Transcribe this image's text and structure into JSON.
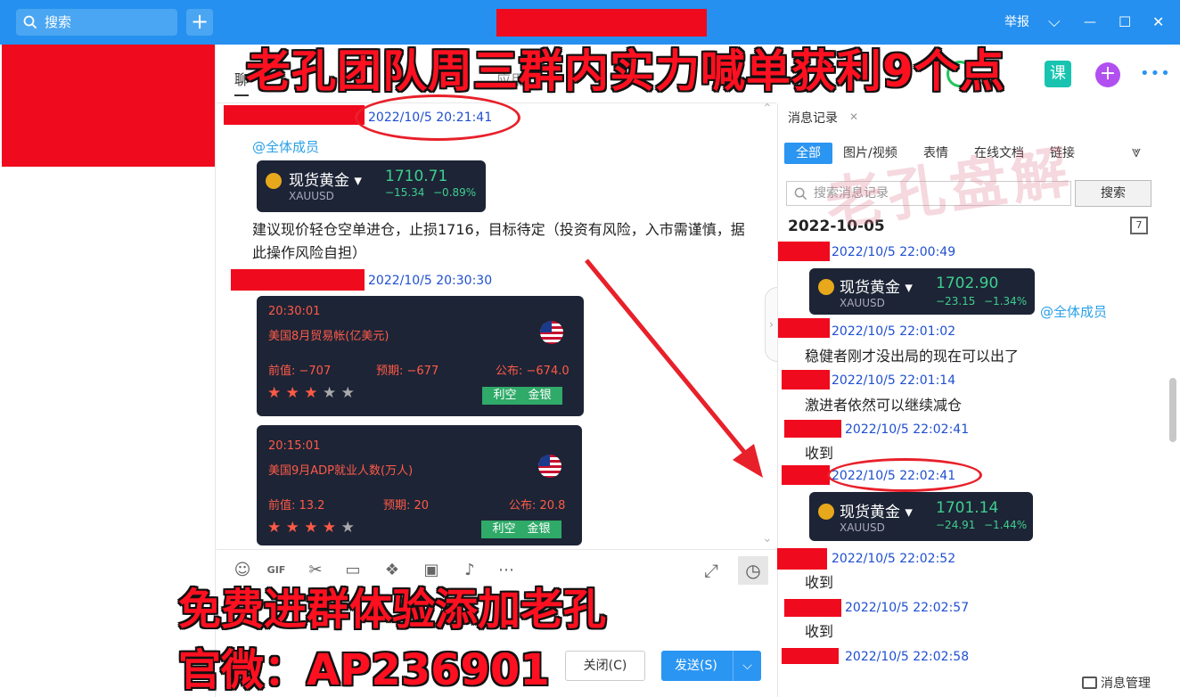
{
  "titlebar": {
    "search_placeholder": "搜索",
    "plus": "+",
    "report": "举报",
    "chevron": "⌵",
    "minimize": "—",
    "maximize": "☐",
    "close": "✕"
  },
  "overlay": {
    "title": "老孔团队周三群内实力喊单获利9个点",
    "bottom_line1": "免费进群体验添加老孔",
    "bottom_line2": "官微：AP236901",
    "watermark": "老孔盘解"
  },
  "tabs": {
    "chat_tab": "聊",
    "apps": "应用",
    "course": "课",
    "more": "•••"
  },
  "chat": {
    "msg1_time": "2022/10/5 20:21:41",
    "msg1_mention": "@全体成员",
    "gold1": {
      "name": "现货黄金",
      "code": "XAUUSD",
      "price": "1710.71",
      "change": "−15.34",
      "pct": "−0.89%"
    },
    "advice": "建议现价轻仓空单进仓，止损1716，目标待定（投资有风险，入市需谨慎，据此操作风险自担）",
    "msg2_time": "2022/10/5 20:30:30",
    "eco1": {
      "time": "20:30:01",
      "title": "美国8月贸易帐(亿美元)",
      "prev": "前值: −707",
      "forecast": "预期: −677",
      "actual": "公布: −674.0",
      "stars": 3,
      "tag": "利空　金银"
    },
    "eco2": {
      "time": "20:15:01",
      "title": "美国9月ADP就业人数(万人)",
      "prev": "前值: 13.2",
      "forecast": "预期: 20",
      "actual": "公布: 20.8",
      "stars": 4,
      "tag": "利空　金银"
    }
  },
  "toolbar": {
    "expand": "⤢",
    "history": "◷"
  },
  "buttons": {
    "close": "关闭(C)",
    "send": "发送(S)",
    "send_arrow": "⌵"
  },
  "history": {
    "title": "消息记录",
    "close": "✕",
    "tabs": [
      "全部",
      "图片/视频",
      "表情",
      "在线文档",
      "链接"
    ],
    "search_placeholder": "搜索消息记录",
    "search_button": "搜索",
    "date": "2022-10-05",
    "calendar": "7",
    "entries": [
      {
        "time": "2022/10/5 22:00:49"
      },
      {
        "time": "2022/10/5 22:01:02",
        "text": "稳健者刚才没出局的现在可以出了"
      },
      {
        "time": "2022/10/5 22:01:14",
        "text": "激进者依然可以继续减仓"
      },
      {
        "time": "2022/10/5 22:02:41",
        "text": "收到"
      },
      {
        "time": "2022/10/5 22:02:41"
      },
      {
        "time": "2022/10/5 22:02:52",
        "text": "收到"
      },
      {
        "time": "2022/10/5 22:02:57",
        "text": "收到"
      },
      {
        "time": "2022/10/5 22:02:58"
      }
    ],
    "mention": "@全体成员",
    "gold_a": {
      "name": "现货黄金",
      "code": "XAUUSD",
      "price": "1702.90",
      "change": "−23.15",
      "pct": "−1.34%"
    },
    "gold_b": {
      "name": "现货黄金",
      "code": "XAUUSD",
      "price": "1701.14",
      "change": "−24.91",
      "pct": "−1.44%"
    },
    "manage": "消息管理"
  },
  "colors": {
    "titlebar": "#2590ef",
    "accent": "#2b95f2",
    "redact": "#f00a1e",
    "overlay_red": "#ff1020",
    "card": "#1d2436",
    "up_green": "#3ecf8e"
  }
}
